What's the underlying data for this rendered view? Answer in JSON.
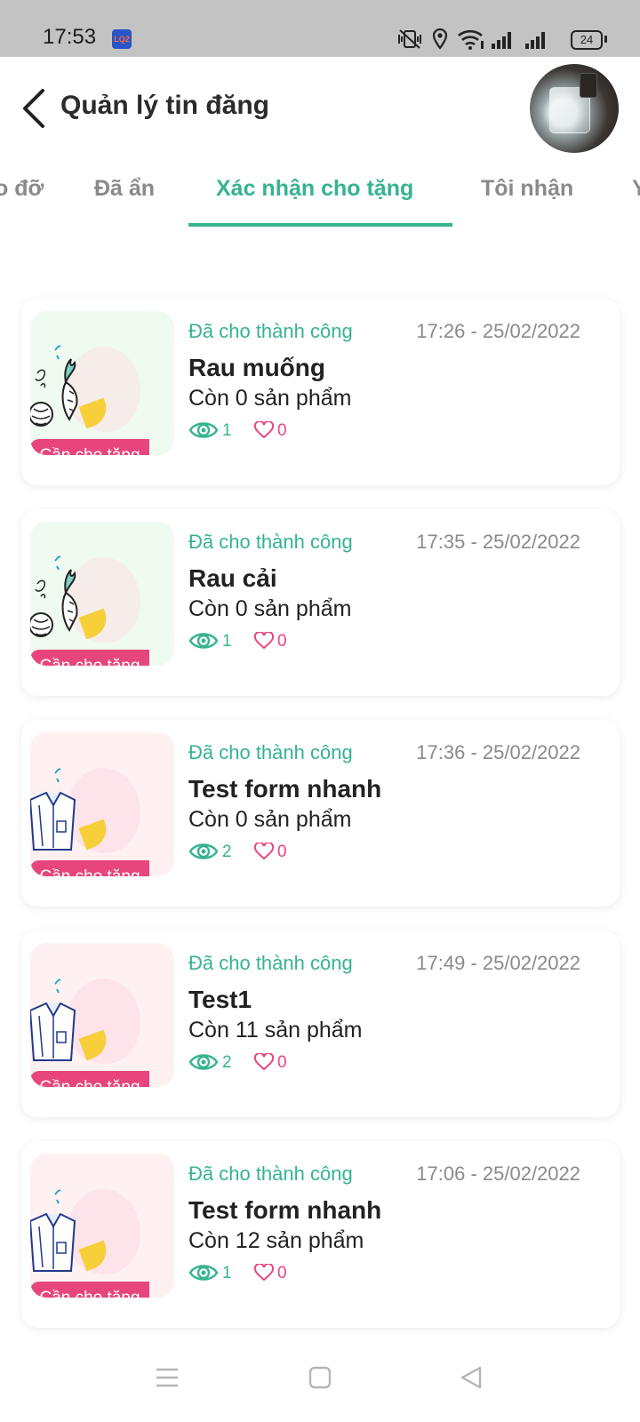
{
  "status_bar": {
    "time": "17:53",
    "app_badge": "LQ2",
    "battery": "24",
    "icons": [
      "vibrate-off-icon",
      "location-icon",
      "wifi-icon",
      "signal-icon",
      "signal-icon",
      "battery-icon"
    ]
  },
  "header": {
    "title": "Quản lý tin đăng",
    "back_icon": "chevron-left-icon"
  },
  "tabs": {
    "items": [
      {
        "label": "o đỡ"
      },
      {
        "label": "Đã ẩn"
      },
      {
        "label": "Xác nhận cho tặng",
        "active": true
      },
      {
        "label": "Tôi nhận"
      },
      {
        "label": "Y"
      }
    ]
  },
  "colors": {
    "accent": "#36b391",
    "badge": "#e8457c",
    "status_bar": "#c3c3c3"
  },
  "listings": [
    {
      "status": "Đã cho thành công",
      "date": "17:26 - 25/02/2022",
      "title": "Rau muống",
      "remaining": "Còn 0 sản phẩm",
      "views": "1",
      "likes": "0",
      "badge": "Cần cho tặng",
      "image": "vegetables"
    },
    {
      "status": "Đã cho thành công",
      "date": "17:35 - 25/02/2022",
      "title": "Rau cải",
      "remaining": "Còn 0 sản phẩm",
      "views": "1",
      "likes": "0",
      "badge": "Cần cho tặng",
      "image": "vegetables"
    },
    {
      "status": "Đã cho thành công",
      "date": "17:36 - 25/02/2022",
      "title": "Test form nhanh",
      "remaining": "Còn 0 sản phẩm",
      "views": "2",
      "likes": "0",
      "badge": "Cần cho tặng",
      "image": "clothing"
    },
    {
      "status": "Đã cho thành công",
      "date": "17:49 - 25/02/2022",
      "title": "Test1",
      "remaining": "Còn 11 sản phẩm",
      "views": "2",
      "likes": "0",
      "badge": "Cần cho tặng",
      "image": "clothing"
    },
    {
      "status": "Đã cho thành công",
      "date": "17:06 - 25/02/2022",
      "title": "Test form nhanh",
      "remaining": "Còn 12 sản phẩm",
      "views": "1",
      "likes": "0",
      "badge": "Cần cho tặng",
      "image": "clothing"
    }
  ],
  "nav_bar": {
    "icons": [
      "menu-icon",
      "home-square-icon",
      "back-triangle-icon"
    ]
  }
}
